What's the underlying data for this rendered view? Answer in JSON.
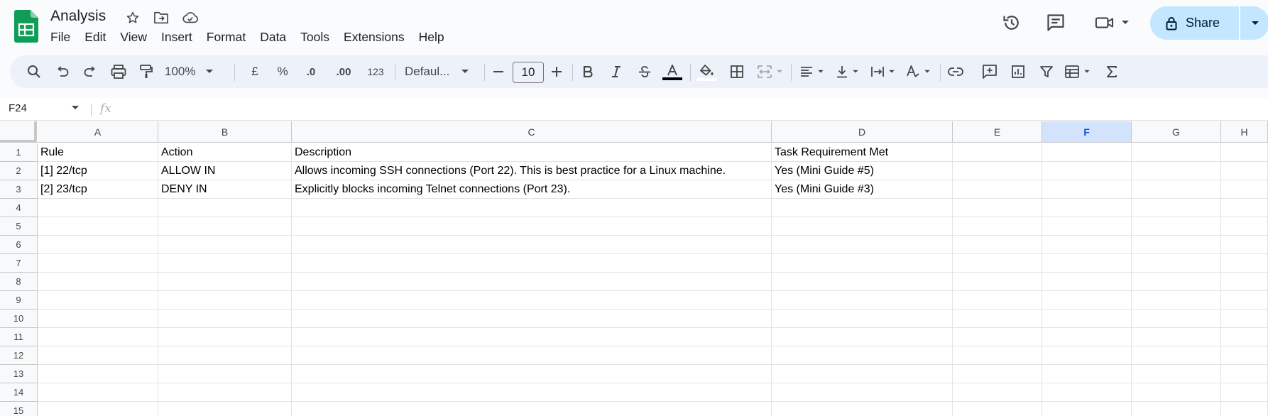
{
  "doc": {
    "title": "Analysis"
  },
  "menu": [
    "File",
    "Edit",
    "View",
    "Insert",
    "Format",
    "Data",
    "Tools",
    "Extensions",
    "Help"
  ],
  "share": {
    "label": "Share"
  },
  "toolbar": {
    "zoom": "100%",
    "currency": "£",
    "percent": "%",
    "dec_decrease": ".0",
    "dec_increase": ".00",
    "number_format": "123",
    "font": "Defaul...",
    "font_size": "10"
  },
  "formula_bar": {
    "cell_ref": "F24",
    "fx": "fx"
  },
  "columns": [
    "A",
    "B",
    "C",
    "D",
    "E",
    "F",
    "G",
    "H"
  ],
  "selected_column": "F",
  "rows": [
    "1",
    "2",
    "3",
    "4",
    "5",
    "6",
    "7",
    "8",
    "9",
    "10",
    "11",
    "12",
    "13",
    "14",
    "15"
  ],
  "cells": [
    [
      "Rule",
      "Action",
      "Description",
      "Task Requirement Met"
    ],
    [
      "[1] 22/tcp",
      "ALLOW IN",
      "Allows incoming SSH connections (Port 22). This is best practice for a Linux machine.",
      "Yes (Mini Guide #5)"
    ],
    [
      "[2] 23/tcp",
      "DENY IN",
      "Explicitly blocks incoming Telnet connections (Port 23).",
      "Yes (Mini Guide #3)"
    ]
  ],
  "colors": {
    "accent": "#0b57d0",
    "share_bg": "#c2e7ff",
    "sheets_green": "#0f9d58"
  }
}
